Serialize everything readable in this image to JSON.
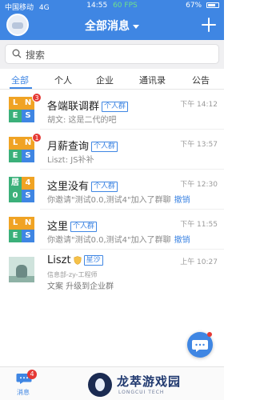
{
  "status_bar": {
    "carrier": "中国移动",
    "network": "4G",
    "time": "14:55",
    "fps": "60 FPS",
    "battery": "67%"
  },
  "header": {
    "title": "全部消息"
  },
  "search": {
    "placeholder": "搜索"
  },
  "tabs": [
    "全部",
    "个人",
    "企业",
    "通讯录",
    "公告"
  ],
  "active_tab": "全部",
  "conversations": [
    {
      "avatar_letters": [
        "L",
        "N",
        "E",
        "S"
      ],
      "avatar_colors": [
        "#f0a324",
        "#f0a324",
        "#3bb07a",
        "#3f86e3"
      ],
      "badge": "3",
      "title": "各端联调群",
      "tag": "个人群",
      "time": "下午 14:12",
      "preview": "胡文: 这是二代的吧",
      "action": ""
    },
    {
      "avatar_letters": [
        "L",
        "N",
        "E",
        "S"
      ],
      "avatar_colors": [
        "#f0a324",
        "#f0a324",
        "#3bb07a",
        "#3f86e3"
      ],
      "badge": "1",
      "title": "月薪查询",
      "tag": "个人群",
      "time": "下午 13:57",
      "preview": "Liszt: JS补补",
      "action": ""
    },
    {
      "avatar_letters": [
        "居",
        "4",
        "0",
        "S"
      ],
      "avatar_colors": [
        "#3bb07a",
        "#f0a324",
        "#3bb07a",
        "#3f86e3"
      ],
      "badge": "",
      "title": "这里没有",
      "tag": "个人群",
      "time": "下午 12:30",
      "preview": "你邀请\"测试0.0,测试4\"加入了群聊",
      "action": "撤销"
    },
    {
      "avatar_letters": [
        "L",
        "N",
        "E",
        "S"
      ],
      "avatar_colors": [
        "#f0a324",
        "#f0a324",
        "#3bb07a",
        "#3f86e3"
      ],
      "badge": "",
      "title": "这里",
      "tag": "个人群",
      "time": "下午 11:55",
      "preview": "你邀请\"测试0.0,测试4\"加入了群聊",
      "action": "撤销"
    }
  ],
  "liszt": {
    "title": "Liszt",
    "tag": "星沙",
    "time": "上午 10:27",
    "subtitle": "信息部-zy-工程师",
    "line2": "文案  升级到企业群"
  },
  "bottom_nav": {
    "messages_label": "消息",
    "messages_badge": "4"
  },
  "watermark": {
    "text": "龙萃游戏园",
    "sub": "LONGCUI TECH"
  }
}
